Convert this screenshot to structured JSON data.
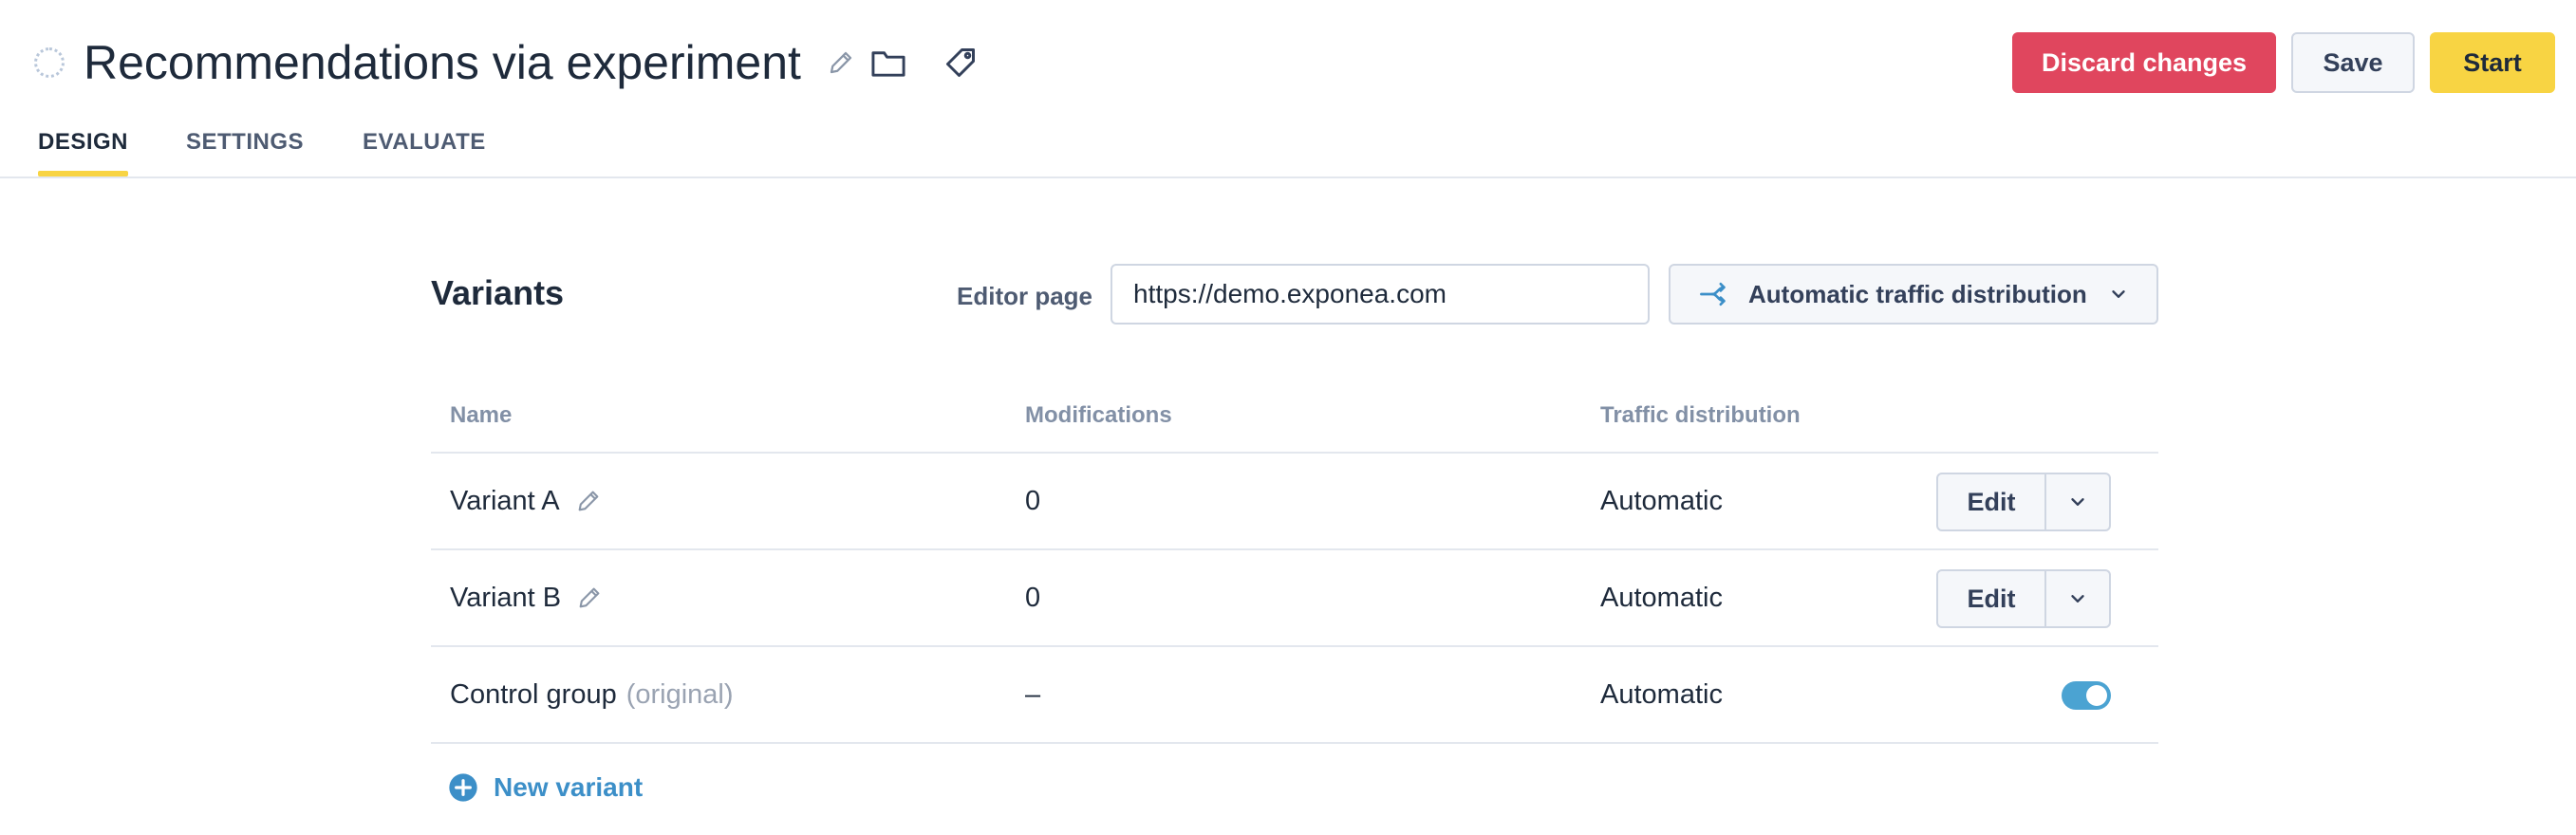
{
  "header": {
    "title": "Recommendations via experiment",
    "buttons": {
      "discard": "Discard changes",
      "save": "Save",
      "start": "Start"
    },
    "tabs": [
      {
        "label": "DESIGN",
        "active": true
      },
      {
        "label": "SETTINGS",
        "active": false
      },
      {
        "label": "EVALUATE",
        "active": false
      }
    ]
  },
  "variants": {
    "title": "Variants",
    "editor_label": "Editor page",
    "editor_url": "https://demo.exponea.com",
    "traffic_button": "Automatic traffic distribution",
    "columns": [
      "Name",
      "Modifications",
      "Traffic distribution"
    ],
    "rows": [
      {
        "name": "Variant A",
        "modifications": "0",
        "traffic": "Automatic",
        "action": "Edit"
      },
      {
        "name": "Variant B",
        "modifications": "0",
        "traffic": "Automatic",
        "action": "Edit"
      },
      {
        "name": "Control group",
        "suffix": "(original)",
        "modifications": "–",
        "traffic": "Automatic",
        "enabled": true
      }
    ],
    "new_variant": "New variant"
  },
  "colors": {
    "accent_yellow": "#f8d443",
    "danger": "#e0465e",
    "link_blue": "#3c8fc8",
    "toggle_on": "#4ba3d2"
  },
  "icons": [
    "status-icon",
    "pencil-icon",
    "folder-icon",
    "tag-icon",
    "share-icon",
    "chevron-down-icon",
    "plus-circle-icon"
  ]
}
